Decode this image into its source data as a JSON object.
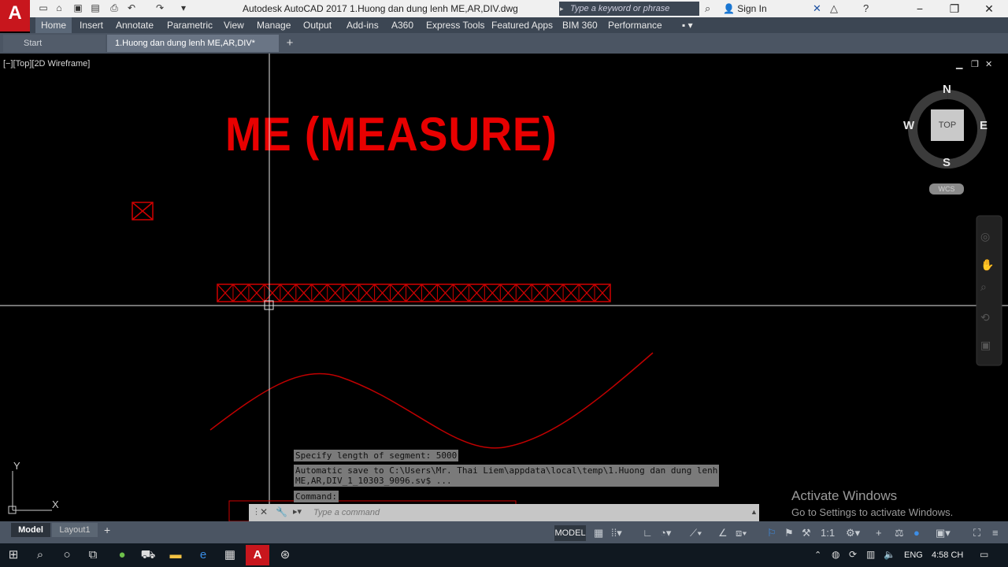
{
  "app": {
    "logo": "A",
    "window_title": "Autodesk AutoCAD 2017    1.Huong dan dung lenh ME,AR,DIV.dwg",
    "search_placeholder": "Type a keyword or phrase",
    "sign_in": "Sign In"
  },
  "ribbon": {
    "tabs": [
      "Home",
      "Insert",
      "Annotate",
      "Parametric",
      "View",
      "Manage",
      "Output",
      "Add-ins",
      "A360",
      "Express Tools",
      "Featured Apps",
      "BIM 360",
      "Performance"
    ]
  },
  "doc_tabs": {
    "start": "Start",
    "active": "1.Huong dan dung lenh ME,AR,DIV*"
  },
  "viewport": {
    "label": "[−][Top][2D Wireframe]",
    "drawing_title": "ME (MEASURE)",
    "measure_marks": 25,
    "ucs": {
      "x": "X",
      "y": "Y"
    }
  },
  "viewcube": {
    "north": "N",
    "south": "S",
    "east": "E",
    "west": "W",
    "face": "TOP",
    "wcs": "WCS"
  },
  "command": {
    "history": [
      "Specify length of segment: 5000",
      "Automatic save to C:\\Users\\Mr. Thai Liem\\appdata\\local\\temp\\1.Huong dan dung lenh\nME,AR,DIV_1_10303_9096.sv$ ...",
      "Command:"
    ],
    "placeholder": "Type a command"
  },
  "watermark": {
    "line1": "Activate Windows",
    "line2": "Go to Settings to activate Windows."
  },
  "status": {
    "model_tab": "Model",
    "layout_tab": "Layout1",
    "model_button": "MODEL",
    "scale": "1:1"
  },
  "taskbar": {
    "language": "ENG",
    "time": "4:58 CH"
  },
  "colors": {
    "drawing_red": "#e80000",
    "ribbon": "#3c4653",
    "viewport": "#000000"
  }
}
